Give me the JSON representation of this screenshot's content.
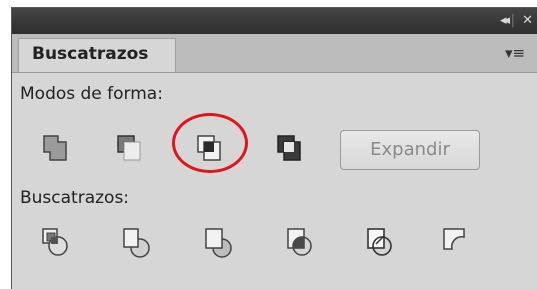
{
  "titlebar": {
    "collapse_icon": "collapse-double-arrow-icon",
    "separator": "|",
    "close_icon": "close-icon",
    "collapse_glyph": "◂◂",
    "close_glyph": "✕"
  },
  "tab": {
    "label": "Buscatrazos",
    "menu_icon": "panel-menu-icon",
    "menu_glyph": "▾≡"
  },
  "shape_modes": {
    "label": "Modos de forma:",
    "buttons": [
      {
        "name": "unite",
        "icon": "unite-icon"
      },
      {
        "name": "minus-front",
        "icon": "minus-front-icon"
      },
      {
        "name": "intersect",
        "icon": "intersect-icon",
        "highlighted": true
      },
      {
        "name": "exclude",
        "icon": "exclude-icon"
      }
    ],
    "expand_label": "Expandir"
  },
  "pathfinders": {
    "label": "Buscatrazos:",
    "buttons": [
      {
        "name": "divide",
        "icon": "divide-icon"
      },
      {
        "name": "trim",
        "icon": "trim-icon"
      },
      {
        "name": "merge",
        "icon": "merge-icon"
      },
      {
        "name": "crop",
        "icon": "crop-icon"
      },
      {
        "name": "outline",
        "icon": "outline-icon"
      },
      {
        "name": "minus-back",
        "icon": "minus-back-icon"
      }
    ]
  },
  "colors": {
    "highlight_ring": "#e0141b",
    "panel_bg": "#d6d6d6",
    "titlebar_bg": "#3c3c3c"
  }
}
